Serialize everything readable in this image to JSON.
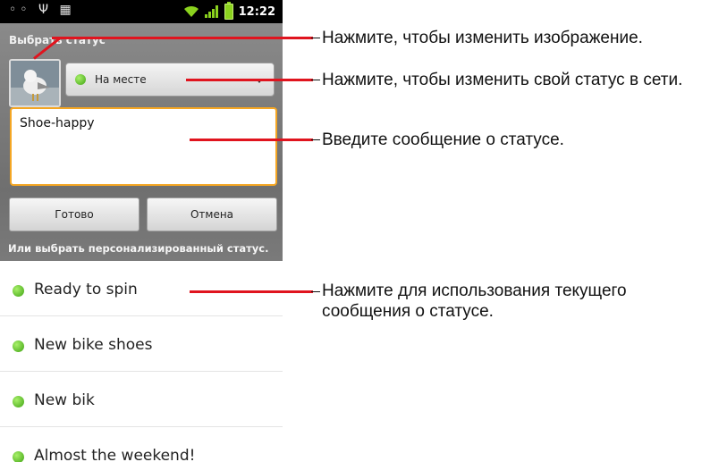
{
  "status_bar": {
    "icons_left": [
      "voicemail-icon",
      "usb-icon",
      "android-debug-icon"
    ],
    "icons_right": [
      "wifi-icon",
      "signal-icon",
      "battery-icon"
    ],
    "time": "12:22"
  },
  "dialog": {
    "title": "Выбрать статус",
    "availability": {
      "label": "На месте",
      "color": "#3fa313"
    },
    "message_value": "Shoe-happy",
    "buttons": {
      "done": "Готово",
      "cancel": "Отмена"
    },
    "custom_header": "Или выбрать персонализированный статус."
  },
  "status_list": [
    {
      "label": "Ready to spin"
    },
    {
      "label": "New bike shoes"
    },
    {
      "label": "New bik"
    },
    {
      "label": "Almost the weekend!"
    }
  ],
  "annotations": [
    {
      "text": "Нажмите, чтобы изменить изображение."
    },
    {
      "text": "Нажмите, чтобы изменить свой статус в сети."
    },
    {
      "text": "Введите сообщение о статусе."
    },
    {
      "text": "Нажмите для использования текущего сообщения о статусе."
    }
  ],
  "colors": {
    "callout_line": "#e0141e",
    "input_focus": "#f4a623",
    "status_green": "#3fa313"
  }
}
